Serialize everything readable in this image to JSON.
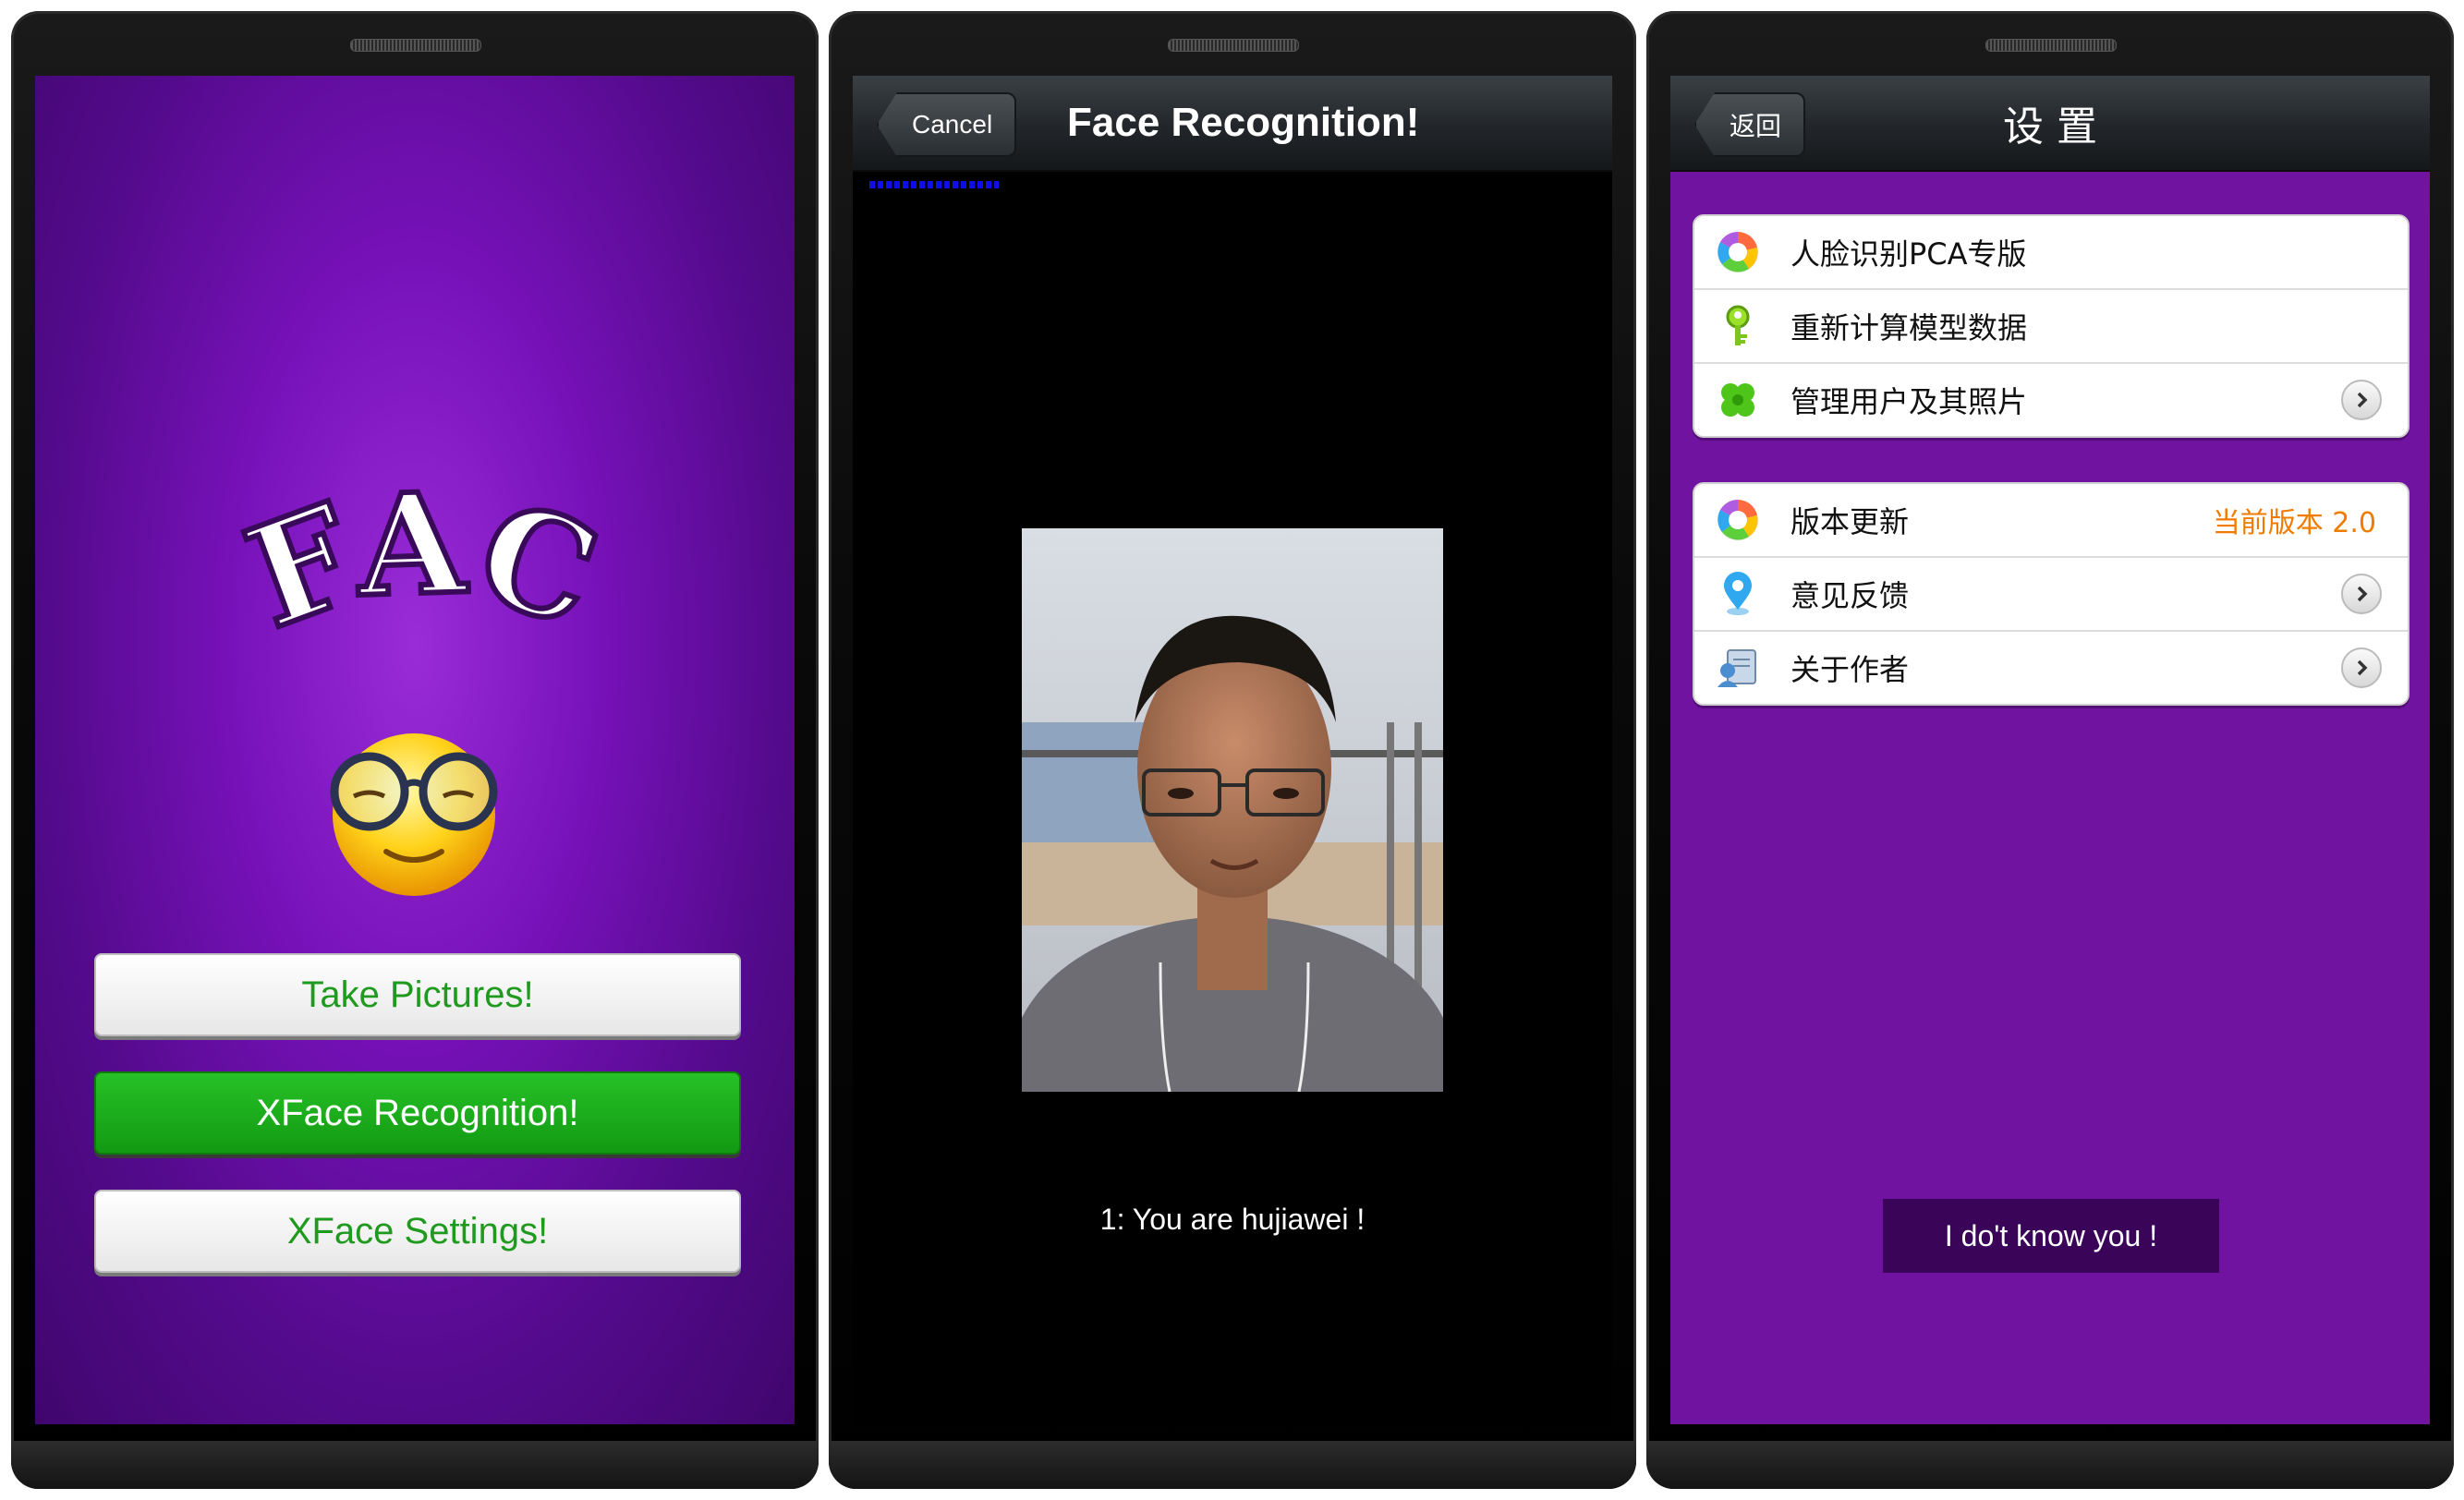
{
  "screen1": {
    "logo_text": "XFACE",
    "buttons": {
      "take_pictures": "Take Pictures!",
      "recognition": "XFace Recognition!",
      "settings": "XFace Settings!"
    }
  },
  "screen2": {
    "back_label": "Cancel",
    "title": "Face Recognition!",
    "result": "1: You are hujiawei !"
  },
  "screen3": {
    "back_label": "返回",
    "title": "设 置",
    "group1": [
      {
        "label": "人脸识别PCA专版",
        "icon": "aperture-icon"
      },
      {
        "label": "重新计算模型数据",
        "icon": "key-icon"
      },
      {
        "label": "管理用户及其照片",
        "icon": "clover-icon"
      }
    ],
    "group2": [
      {
        "label": "版本更新",
        "icon": "aperture-icon",
        "value": "当前版本 2.0"
      },
      {
        "label": "意见反馈",
        "icon": "location-pin-icon"
      },
      {
        "label": "关于作者",
        "icon": "user-card-icon"
      }
    ],
    "toast": "I do't know you !"
  },
  "colors": {
    "purple_bg": "#7013a0",
    "accent_green": "#1f9a1f",
    "orange_value": "#f07b00"
  }
}
